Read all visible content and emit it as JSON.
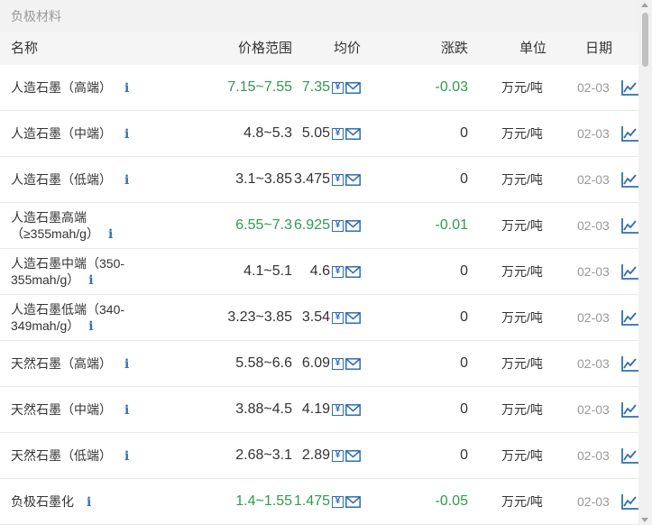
{
  "section_title": "负极材料",
  "headers": {
    "name": "名称",
    "range": "价格范围",
    "avg": "均价",
    "change": "涨跌",
    "unit": "单位",
    "date": "日期"
  },
  "colors": {
    "up_down_green": "#2e9b4f",
    "icon_blue": "#2f6db5",
    "date_gray": "#999999"
  },
  "rows": [
    {
      "name_lines": [
        "人造石墨（高端）"
      ],
      "range": "7.15~7.55",
      "avg": "7.35",
      "change": "-0.03",
      "unit": "万元/吨",
      "date": "02-03",
      "highlight": true
    },
    {
      "name_lines": [
        "人造石墨（中端）"
      ],
      "range": "4.8~5.3",
      "avg": "5.05",
      "change": "0",
      "unit": "万元/吨",
      "date": "02-03",
      "highlight": false
    },
    {
      "name_lines": [
        "人造石墨（低端）"
      ],
      "range": "3.1~3.85",
      "avg": "3.475",
      "change": "0",
      "unit": "万元/吨",
      "date": "02-03",
      "highlight": false
    },
    {
      "name_lines": [
        "人造石墨高端",
        "（≥355mah/g）"
      ],
      "range": "6.55~7.3",
      "avg": "6.925",
      "change": "-0.01",
      "unit": "万元/吨",
      "date": "02-03",
      "highlight": true
    },
    {
      "name_lines": [
        "人造石墨中端（350-",
        "355mah/g）"
      ],
      "range": "4.1~5.1",
      "avg": "4.6",
      "change": "0",
      "unit": "万元/吨",
      "date": "02-03",
      "highlight": false
    },
    {
      "name_lines": [
        "人造石墨低端（340-",
        "349mah/g）"
      ],
      "range": "3.23~3.85",
      "avg": "3.54",
      "change": "0",
      "unit": "万元/吨",
      "date": "02-03",
      "highlight": false
    },
    {
      "name_lines": [
        "天然石墨（高端）"
      ],
      "range": "5.58~6.6",
      "avg": "6.09",
      "change": "0",
      "unit": "万元/吨",
      "date": "02-03",
      "highlight": false
    },
    {
      "name_lines": [
        "天然石墨（中端）"
      ],
      "range": "3.88~4.5",
      "avg": "4.19",
      "change": "0",
      "unit": "万元/吨",
      "date": "02-03",
      "highlight": false
    },
    {
      "name_lines": [
        "天然石墨（低端）"
      ],
      "range": "2.68~3.1",
      "avg": "2.89",
      "change": "0",
      "unit": "万元/吨",
      "date": "02-03",
      "highlight": false
    },
    {
      "name_lines": [
        "负极石墨化"
      ],
      "range": "1.4~1.55",
      "avg": "1.475",
      "change": "-0.05",
      "unit": "万元/吨",
      "date": "02-03",
      "highlight": true
    }
  ],
  "icons": {
    "info": "info-icon",
    "price_alert": "yen-box-icon",
    "subscribe": "envelope-icon",
    "chart": "line-chart-icon"
  }
}
